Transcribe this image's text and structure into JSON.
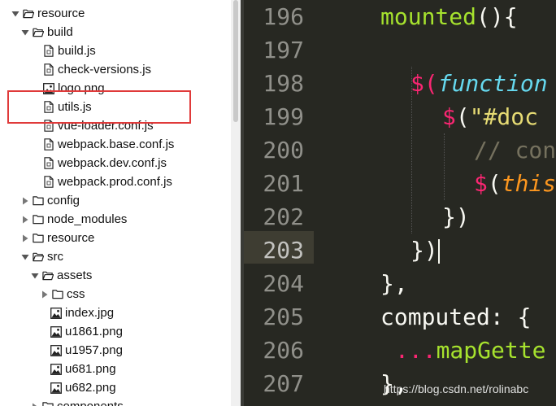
{
  "tree": {
    "items": [
      {
        "label": "resource",
        "type": "folder-open"
      },
      {
        "label": "build",
        "type": "folder-open"
      },
      {
        "label": "build.js",
        "type": "file"
      },
      {
        "label": "check-versions.js",
        "type": "file"
      },
      {
        "label": "logo.png",
        "type": "image"
      },
      {
        "label": "utils.js",
        "type": "file"
      },
      {
        "label": "vue-loader.conf.js",
        "type": "file"
      },
      {
        "label": "webpack.base.conf.js",
        "type": "file"
      },
      {
        "label": "webpack.dev.conf.js",
        "type": "file"
      },
      {
        "label": "webpack.prod.conf.js",
        "type": "file"
      },
      {
        "label": "config",
        "type": "folder-closed"
      },
      {
        "label": "node_modules",
        "type": "folder-closed"
      },
      {
        "label": "resource",
        "type": "folder-closed"
      },
      {
        "label": "src",
        "type": "folder-open"
      },
      {
        "label": "assets",
        "type": "folder-open"
      },
      {
        "label": "css",
        "type": "folder-closed"
      },
      {
        "label": "index.jpg",
        "type": "image"
      },
      {
        "label": "u1861.png",
        "type": "image"
      },
      {
        "label": "u1957.png",
        "type": "image"
      },
      {
        "label": "u681.png",
        "type": "image"
      },
      {
        "label": "u682.png",
        "type": "image"
      },
      {
        "label": "components",
        "type": "folder-closed"
      }
    ]
  },
  "editor": {
    "line_numbers": [
      "196",
      "197",
      "198",
      "199",
      "200",
      "201",
      "202",
      "203",
      "204",
      "205",
      "206",
      "207"
    ],
    "code": {
      "l196_name": "mounted",
      "l196_rest": "(){",
      "l198_dollar": "$",
      "l198_paren": "(",
      "l198_fn": "function",
      "l199_dollar": "$",
      "l199_paren": "(",
      "l199_str": "\"#doc",
      "l200_comment": "// con",
      "l201_dollar": "$",
      "l201_paren": "(",
      "l201_this": "this",
      "l202_text": "})",
      "l203_text": "})",
      "l204_text": "},",
      "l205_text": "computed: {",
      "l206_dots": "...",
      "l206_name": "mapGette",
      "l207_text": "},"
    }
  },
  "watermark": "https://blog.csdn.net/rolinabc",
  "colors": {
    "editor_bg": "#272822",
    "highlight_box": "#e03a3a",
    "function_green": "#a6e22e",
    "keyword_pink": "#f92672"
  }
}
